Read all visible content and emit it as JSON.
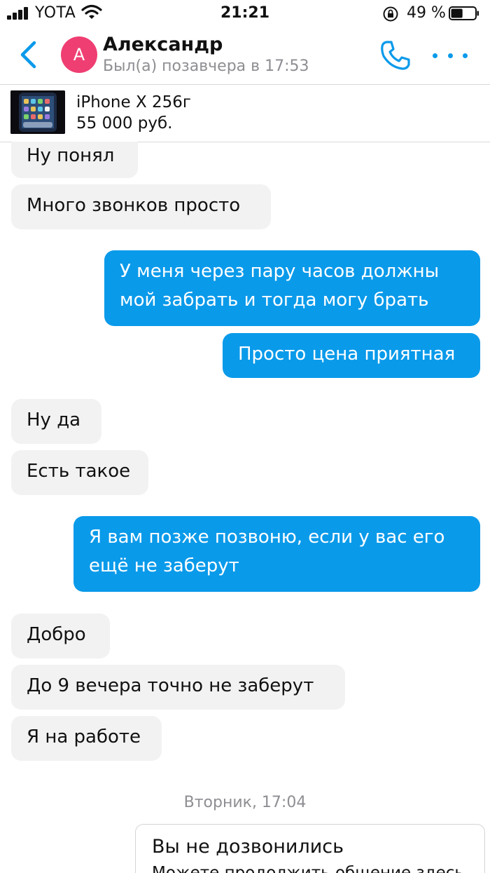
{
  "status_bar": {
    "carrier": "YOTA",
    "time": "21:21",
    "battery_percent": "49 %",
    "battery_level": 0.49
  },
  "header": {
    "avatar_letter": "A",
    "contact_name": "Александр",
    "last_seen": "Был(а) позавчера в 17:53",
    "accent_color": "#0a9aea",
    "avatar_color": "#ef3e72"
  },
  "listing": {
    "title": "iPhone X 256г",
    "price": "55 000 руб."
  },
  "messages": [
    {
      "direction": "in",
      "text": "Ну понял"
    },
    {
      "direction": "in",
      "text": "Много звонков просто"
    },
    {
      "direction": "out",
      "text": "У меня через пару часов должны\nмой забрать и тогда могу брать"
    },
    {
      "direction": "out",
      "text": "Просто цена приятная"
    },
    {
      "direction": "in",
      "text": "Ну да"
    },
    {
      "direction": "in",
      "text": "Есть такое"
    },
    {
      "direction": "out",
      "text": "Я вам позже позвоню, если у вас его\nещё не заберут"
    },
    {
      "direction": "in",
      "text": "Добро"
    },
    {
      "direction": "in",
      "text": "До 9 вечера точно не заберут"
    },
    {
      "direction": "in",
      "text": "Я на работе"
    }
  ],
  "date_separator": "Вторник, 17:04",
  "system_message": {
    "title": "Вы не дозвонились",
    "subtitle": "Можете продолжить общение здесь"
  }
}
